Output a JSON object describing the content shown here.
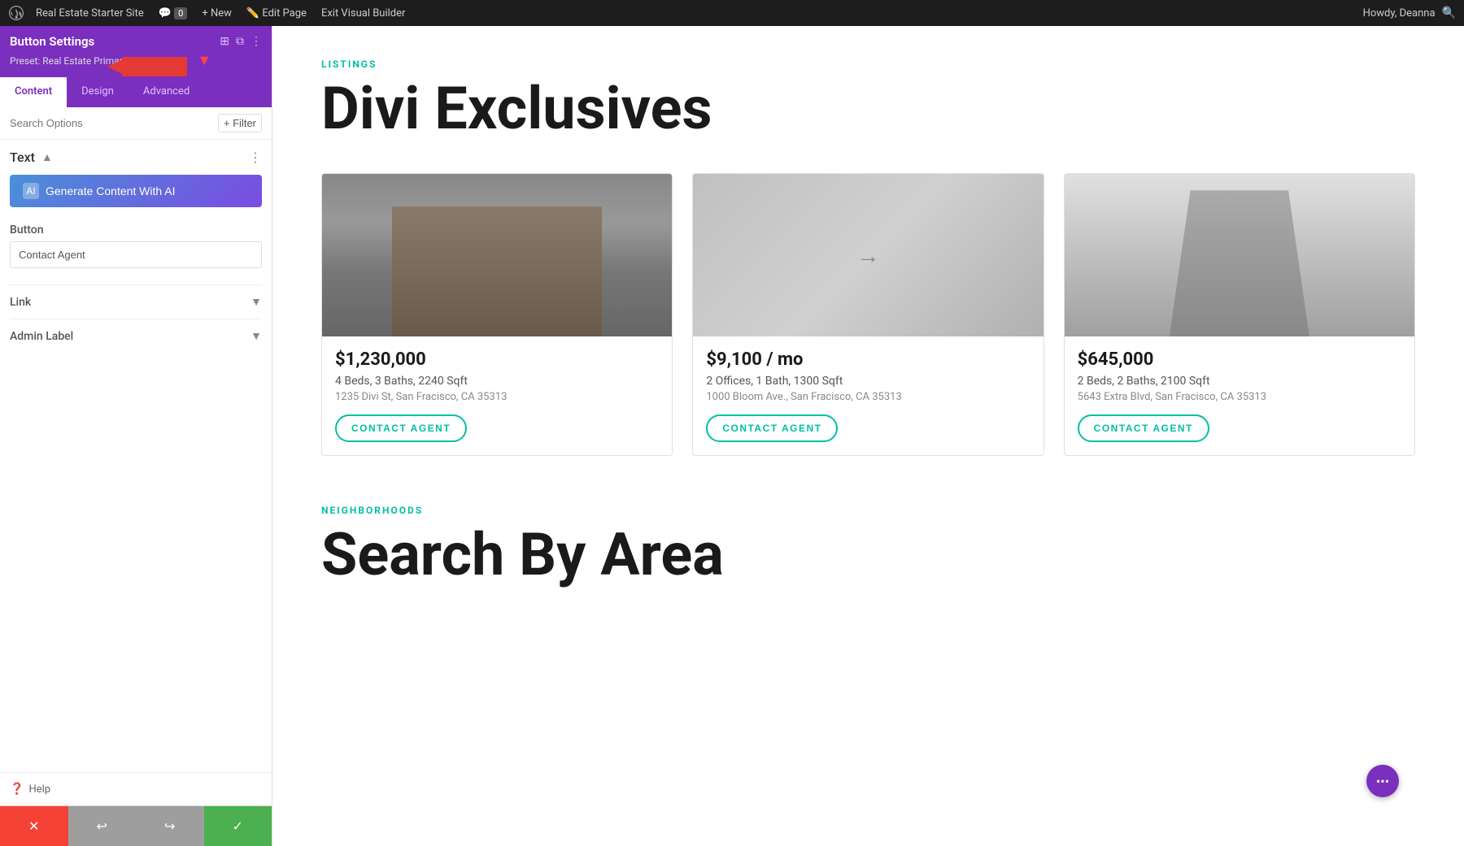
{
  "adminBar": {
    "siteName": "Real Estate Starter Site",
    "commentCount": "0",
    "newLabel": "+ New",
    "editPageLabel": "Edit Page",
    "exitBuilderLabel": "Exit Visual Builder",
    "howdy": "Howdy, Deanna"
  },
  "panel": {
    "title": "Button Settings",
    "preset": "Preset: Real Estate Primary Outline Small",
    "tabs": {
      "content": "Content",
      "design": "Design",
      "advanced": "Advanced"
    },
    "search": {
      "placeholder": "Search Options",
      "filterLabel": "+ Filter"
    },
    "textSection": {
      "label": "Text",
      "aiBtn": "Generate Content With AI"
    },
    "buttonSection": {
      "label": "Button",
      "value": "Contact Agent"
    },
    "linkSection": {
      "label": "Link"
    },
    "adminLabelSection": {
      "label": "Admin Label"
    },
    "help": "Help"
  },
  "toolbar": {
    "cancelIcon": "✕",
    "undoIcon": "↩",
    "redoIcon": "↪",
    "saveIcon": "✓"
  },
  "content": {
    "listingsTag": "LISTINGS",
    "mainHeading": "Divi Exclusives",
    "cards": [
      {
        "price": "$1,230,000",
        "details": "4 Beds, 3 Baths, 2240 Sqft",
        "address": "1235 Divi St, San Fracisco, CA 35313",
        "contactBtn": "CONTACT AGENT",
        "imageType": "building1"
      },
      {
        "price": "$9,100 / mo",
        "details": "2 Offices, 1 Bath, 1300 Sqft",
        "address": "1000 Bloom Ave., San Fracisco, CA 35313",
        "contactBtn": "CONTACT AGENT",
        "imageType": "building2"
      },
      {
        "price": "$645,000",
        "details": "2 Beds, 2 Baths, 2100 Sqft",
        "address": "5643 Extra Blvd, San Fracisco, CA 35313",
        "contactBtn": "CONTACT AGENT",
        "imageType": "building3"
      }
    ],
    "neighborhoodsTag": "NEIGHBORHOODS",
    "neighborhoodsHeading": "Search By Area"
  },
  "floatingBtn": {
    "label": "•••"
  }
}
